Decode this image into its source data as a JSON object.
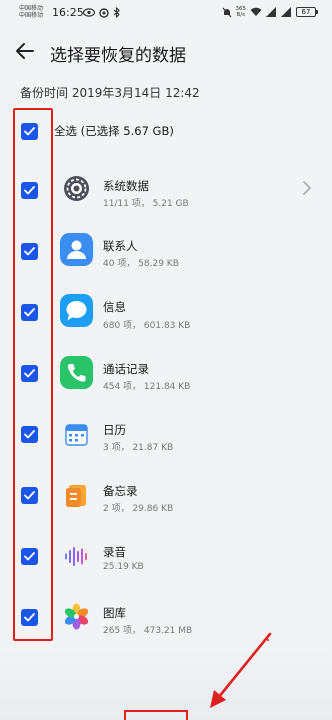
{
  "status_bar": {
    "carrier_1": "中国移动",
    "carrier_2": "中国移动",
    "time": "16:25",
    "net_speed_value": "365",
    "net_speed_unit": "B/s",
    "battery": "67"
  },
  "header": {
    "title": "选择要恢复的数据"
  },
  "backup_time": "备份时间 2019年3月14日 12:42",
  "select_all": {
    "label": "全选 (已选择 5.67 GB)",
    "checked": true
  },
  "items": [
    {
      "title": "系统数据",
      "subtitle": "11/11 项， 5.21 GB",
      "icon": "system-data-gear-icon",
      "checked": true,
      "has_chevron": true
    },
    {
      "title": "联系人",
      "subtitle": "40 项， 58.29 KB",
      "icon": "contacts-icon",
      "checked": true
    },
    {
      "title": "信息",
      "subtitle": "680 项， 601.83 KB",
      "icon": "messages-icon",
      "checked": true
    },
    {
      "title": "通话记录",
      "subtitle": "454 项， 121.84 KB",
      "icon": "call-log-icon",
      "checked": true
    },
    {
      "title": "日历",
      "subtitle": "3 项， 21.87 KB",
      "icon": "calendar-icon",
      "checked": true
    },
    {
      "title": "备忘录",
      "subtitle": "2 项， 29.86 KB",
      "icon": "notes-icon",
      "checked": true
    },
    {
      "title": "录音",
      "subtitle": "25.19 KB",
      "icon": "recorder-icon",
      "checked": true
    },
    {
      "title": "图库",
      "subtitle": "265 项， 473.21 MB",
      "icon": "gallery-icon",
      "checked": true
    }
  ],
  "colors": {
    "checkbox": "#1a56e8",
    "annotation": "#e02020",
    "background": "#f1f3f5"
  }
}
